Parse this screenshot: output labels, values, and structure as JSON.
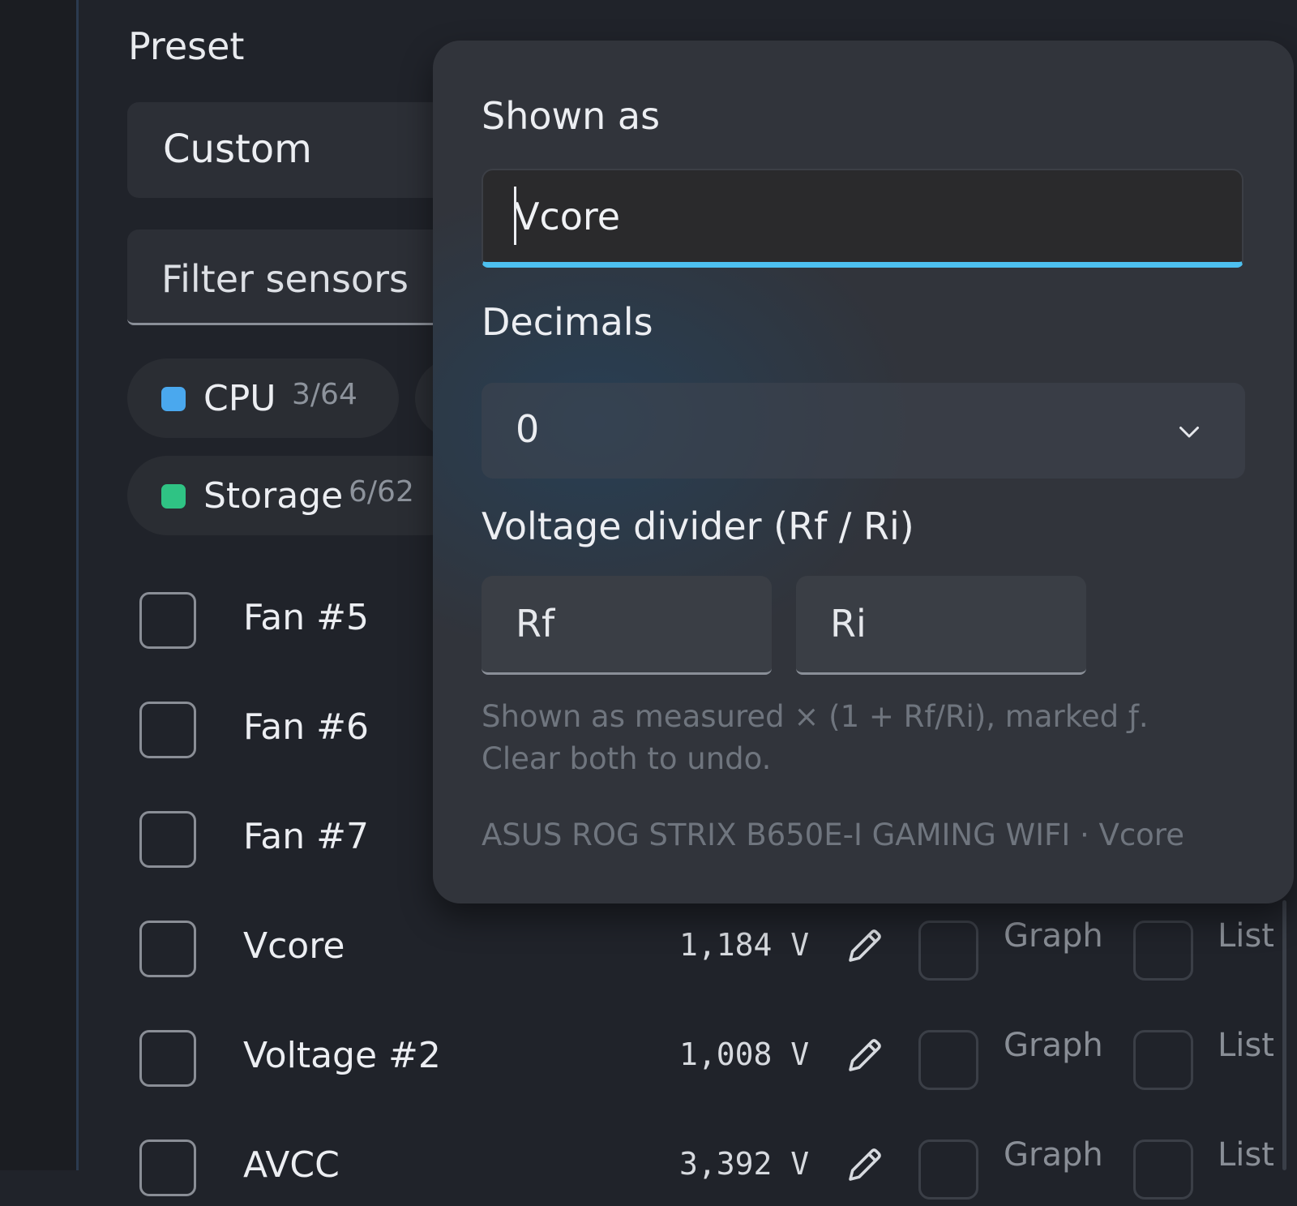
{
  "preset": {
    "title": "Preset",
    "selected": "Custom"
  },
  "filter": {
    "placeholder": "Filter sensors"
  },
  "chips": [
    {
      "name": "CPU",
      "count": "3/64",
      "color": "#4aa8ee"
    },
    {
      "name": "Storage",
      "count": "6/62",
      "color": "#2fc384"
    }
  ],
  "sensors": [
    {
      "label": "Fan #5"
    },
    {
      "label": "Fan #6"
    },
    {
      "label": "Fan #7"
    },
    {
      "label": "Vcore",
      "value": "1,184 V",
      "graph": "Graph",
      "list": "List"
    },
    {
      "label": "Voltage #2",
      "value": "1,008 V",
      "graph": "Graph",
      "list": "List"
    },
    {
      "label": "AVCC",
      "value": "3,392 V",
      "graph": "Graph",
      "list": "List"
    }
  ],
  "popover": {
    "shown_as_label": "Shown as",
    "shown_as_value": "Vcore",
    "decimals_label": "Decimals",
    "decimals_value": "0",
    "divider_label": "Voltage divider (Rf / Ri)",
    "rf_placeholder": "Rf",
    "ri_placeholder": "Ri",
    "hint": "Shown as measured × (1 + Rf/Ri), marked ƒ. Clear both to undo.",
    "device": "ASUS ROG STRIX B650E-I GAMING WIFI · Vcore"
  },
  "colors": {
    "accent": "#4dc0f0",
    "background": "#20232a",
    "popover": "#31343b"
  }
}
